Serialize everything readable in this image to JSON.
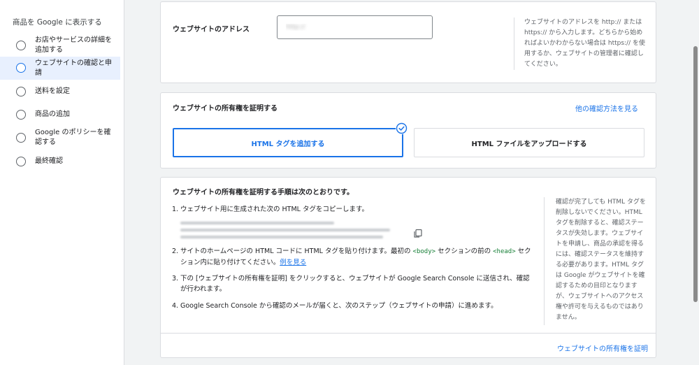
{
  "sidebar": {
    "title": "商品を Google に表示する",
    "steps": [
      {
        "label": "お店やサービスの詳細を追加する",
        "active": false
      },
      {
        "label": "ウェブサイトの確認と申請",
        "active": true
      },
      {
        "label": "送料を設定",
        "active": false
      },
      {
        "label": "商品の追加",
        "active": false
      },
      {
        "label": "Google のポリシーを確認する",
        "active": false
      },
      {
        "label": "最終確認",
        "active": false
      }
    ]
  },
  "website": {
    "label": "ウェブサイトのアドレス",
    "value": "http://",
    "help": "ウェブサイトのアドレスを http:// または https:// から入力します。どちらから始めればよいかわからない場合は https:// を使用するか、ウェブサイトの管理者に確認してください。"
  },
  "ownership": {
    "title": "ウェブサイトの所有権を証明する",
    "other_link": "他の確認方法を見る",
    "option_html_tag": "HTML タグを追加する",
    "option_html_file": "HTML ファイルをアップロードする"
  },
  "instructions": {
    "title": "ウェブサイトの所有権を証明する手順は次のとおりです。",
    "step1": "ウェブサイト用に生成された次の HTML タグをコピーします。",
    "step2_a": "サイトのホームページの HTML コードに HTML タグを貼り付けます。最初の ",
    "step2_body": "<body>",
    "step2_b": " セクションの前の ",
    "step2_head": "<head>",
    "step2_c": " セクション内に貼り付けてください。",
    "step2_link": "例を見る",
    "step3": "下の [ウェブサイトの所有権を証明] をクリックすると、ウェブサイトが Google Search Console に送信され、確認が行われます。",
    "step4": "Google Search Console から確認のメールが届くと、次のステップ（ウェブサイトの申請）に進めます。",
    "help": "確認が完了しても HTML タグを削除しないでください。HTML タグを削除すると、確認ステータスが失効します。ウェブサイトを申請し、商品の承認を得るには、確認ステータスを維持する必要があります。HTML タグは Google がウェブサイトを確認するための目印となりますが、ウェブサイトへのアクセス権や許可を与えるものではありません。",
    "verify_button": "ウェブサイトの所有権を証明"
  },
  "colors": {
    "accent": "#1a73e8",
    "code_green": "#188038",
    "active_bg": "#e8f0fe"
  }
}
